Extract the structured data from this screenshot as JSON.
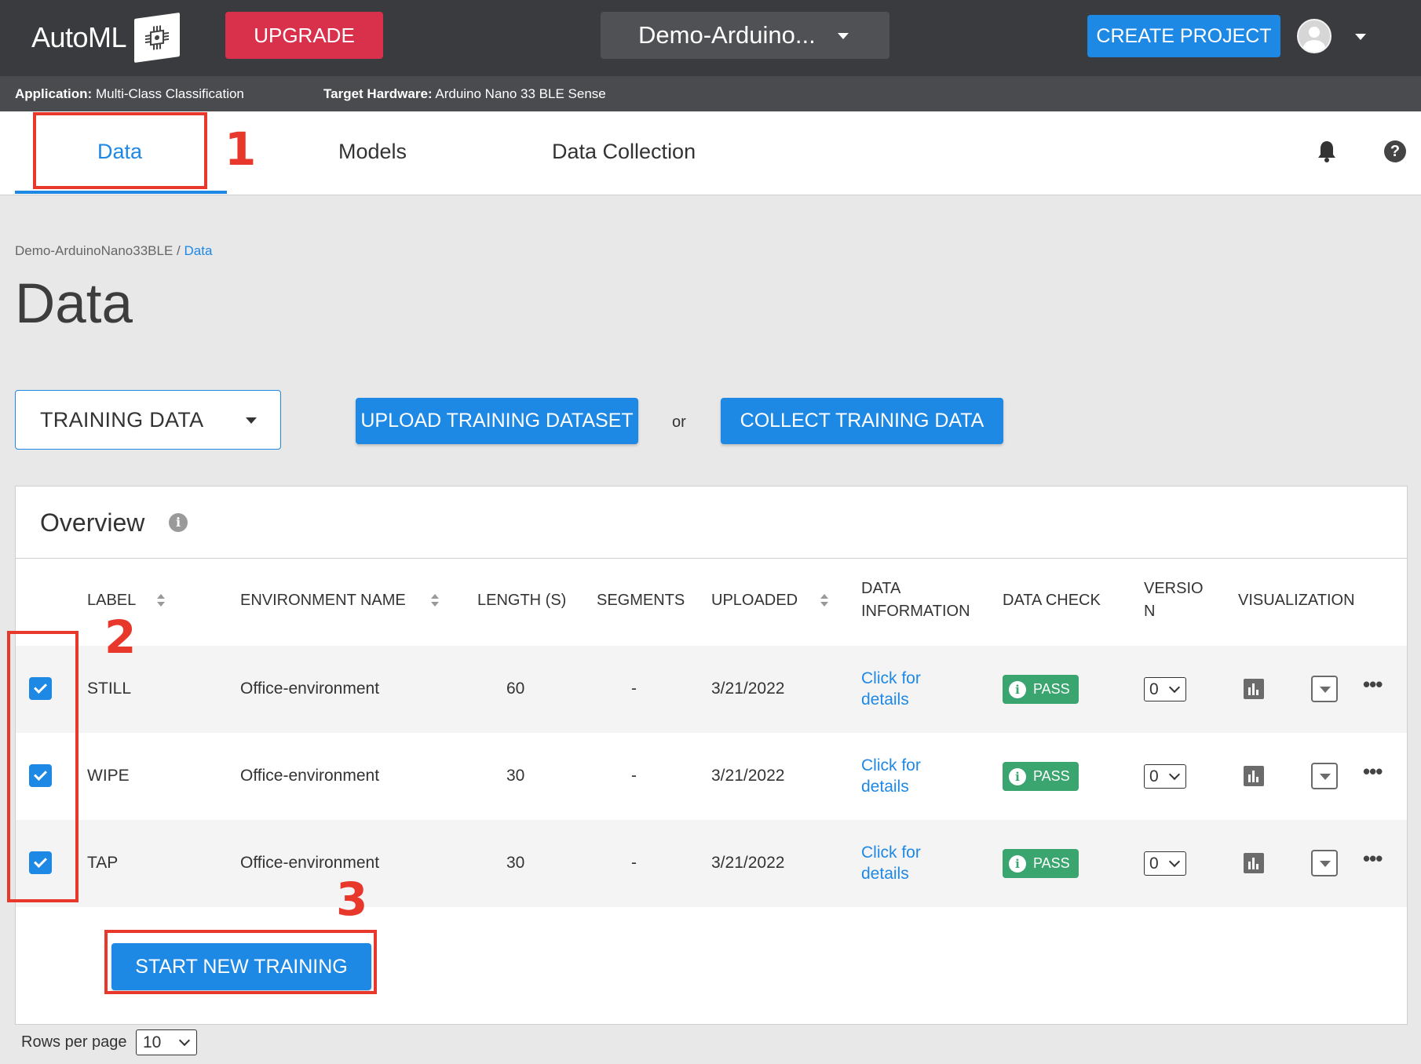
{
  "app": {
    "logo_text": "AutoML",
    "upgrade_label": "UPGRADE",
    "project_name": "Demo-Arduino...",
    "create_project_label": "CREATE PROJECT"
  },
  "infobar": {
    "application_label": "Application:",
    "application_value": "Multi-Class Classification",
    "hardware_label": "Target Hardware:",
    "hardware_value": "Arduino Nano 33 BLE Sense"
  },
  "tabs": [
    {
      "label": "Data",
      "active": true
    },
    {
      "label": "Models",
      "active": false
    },
    {
      "label": "Data Collection",
      "active": false
    }
  ],
  "breadcrumb": {
    "parent": "Demo-ArduinoNano33BLE",
    "separator": "/",
    "current": "Data"
  },
  "page_title": "Data",
  "actions": {
    "dataset_selected": "TRAINING DATA",
    "upload_label": "UPLOAD TRAINING DATASET",
    "or_text": "or",
    "collect_label": "COLLECT TRAINING DATA"
  },
  "overview": {
    "title": "Overview",
    "columns": {
      "label": "LABEL",
      "environment": "ENVIRONMENT NAME",
      "length": "LENGTH (S)",
      "segments": "SEGMENTS",
      "uploaded": "UPLOADED",
      "data_info_1": "DATA",
      "data_info_2": "INFORMATION",
      "data_check": "DATA CHECK",
      "version_1": "VERSIO",
      "version_2": "N",
      "visualization": "VISUALIZATION"
    },
    "rows": [
      {
        "label": "STILL",
        "environment": "Office-environment",
        "length": "60",
        "segments": "-",
        "uploaded": "3/21/2022",
        "info_1": "Click for",
        "info_2": "details",
        "check": "PASS",
        "version": "0",
        "checked": true
      },
      {
        "label": "WIPE",
        "environment": "Office-environment",
        "length": "30",
        "segments": "-",
        "uploaded": "3/21/2022",
        "info_1": "Click for",
        "info_2": "details",
        "check": "PASS",
        "version": "0",
        "checked": true
      },
      {
        "label": "TAP",
        "environment": "Office-environment",
        "length": "30",
        "segments": "-",
        "uploaded": "3/21/2022",
        "info_1": "Click for",
        "info_2": "details",
        "check": "PASS",
        "version": "0",
        "checked": true
      }
    ],
    "start_training_label": "START NEW TRAINING"
  },
  "pagination": {
    "rows_per_page_label": "Rows per page",
    "rows_per_page_value": "10"
  },
  "annotations": [
    "1",
    "2",
    "3"
  ],
  "colors": {
    "accent": "#1e88e5",
    "upgrade": "#d9304c",
    "pass": "#3aa56f",
    "annotation": "#e8382c",
    "topbar": "#3a3b3e"
  },
  "icons": [
    "chip-logo-icon",
    "caret-down-icon",
    "avatar-icon",
    "bell-icon",
    "help-icon",
    "info-icon",
    "sort-icon",
    "check-icon",
    "chart-icon",
    "download-icon",
    "more-icon"
  ]
}
